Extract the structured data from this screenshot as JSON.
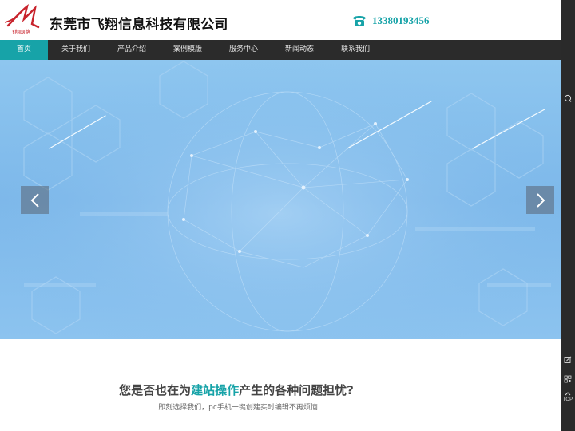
{
  "header": {
    "company_name": "东莞市飞翔信息科技有限公司",
    "logo_text": "飞翔网络",
    "phone": "13380193456"
  },
  "nav": {
    "items": [
      {
        "label": "首页"
      },
      {
        "label": "关于我们"
      },
      {
        "label": "产品介绍"
      },
      {
        "label": "案例模版"
      },
      {
        "label": "服务中心"
      },
      {
        "label": "新闻动态"
      },
      {
        "label": "联系我们"
      }
    ],
    "active_index": 0
  },
  "banner": {
    "prev_icon": "chevron-left-icon",
    "next_icon": "chevron-right-icon"
  },
  "rightbar": {
    "icons": [
      "chat-icon",
      "edit-icon",
      "qrcode-icon",
      "back-to-top-icon"
    ],
    "top_label": "TOP"
  },
  "section": {
    "title_before": "您是否也在为",
    "title_highlight": "建站操作",
    "title_after": "产生的各种问题担忧?",
    "subtitle": "即刻选择我们，pc手机一键创建实时编辑不再烦恼"
  },
  "colors": {
    "accent": "#17a3a8",
    "nav_bg": "#2b2b2b",
    "banner_blue": "#7db8ea"
  }
}
